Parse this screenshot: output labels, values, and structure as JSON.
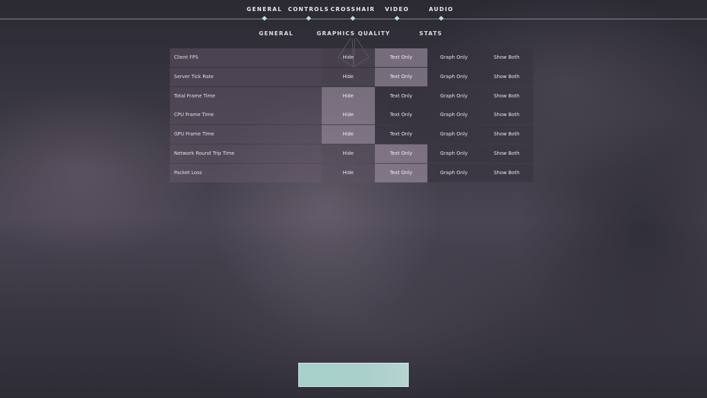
{
  "top_nav": {
    "items": [
      {
        "label": "GENERAL"
      },
      {
        "label": "CONTROLS"
      },
      {
        "label": "CROSSHAIR"
      },
      {
        "label": "VIDEO"
      },
      {
        "label": "AUDIO"
      }
    ]
  },
  "sub_nav": {
    "items": [
      {
        "label": "GENERAL"
      },
      {
        "label": "GRAPHICS QUALITY"
      },
      {
        "label": "STATS"
      }
    ],
    "active": "STATS"
  },
  "stats": {
    "options": [
      "Hide",
      "Text Only",
      "Graph Only",
      "Show Both"
    ],
    "rows": [
      {
        "label": "Client FPS",
        "selected": "Text Only"
      },
      {
        "label": "Server Tick Rate",
        "selected": "Text Only"
      },
      {
        "label": "Total Frame Time",
        "selected": "Hide"
      },
      {
        "label": "CPU Frame Time",
        "selected": "Hide"
      },
      {
        "label": "GPU Frame Time",
        "selected": "Hide"
      },
      {
        "label": "Network Round Trip Time",
        "selected": "Text Only"
      },
      {
        "label": "Packet Loss",
        "selected": "Text Only"
      }
    ]
  },
  "colors": {
    "accent": "#a8d0cb",
    "nav_text": "#e6eceb"
  }
}
